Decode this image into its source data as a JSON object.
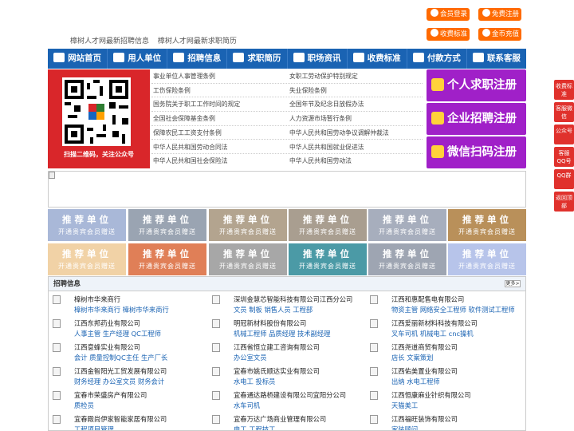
{
  "header": {
    "links": [
      "樟树人才网最新招聘信息",
      "樟树人才网最新求职简历"
    ],
    "buttons": [
      {
        "label": "会员登录",
        "icon": "user-icon"
      },
      {
        "label": "免费注册",
        "icon": "register-icon"
      },
      {
        "label": "收费标准",
        "icon": "yen-icon"
      },
      {
        "label": "金币充值",
        "icon": "coin-icon"
      }
    ]
  },
  "nav": [
    {
      "label": "网站首页",
      "icon": "home-icon"
    },
    {
      "label": "用人单位",
      "icon": "building-icon"
    },
    {
      "label": "招聘信息",
      "icon": "recruit-icon"
    },
    {
      "label": "求职简历",
      "icon": "resume-icon"
    },
    {
      "label": "职场资讯",
      "icon": "news-icon"
    },
    {
      "label": "收费标准",
      "icon": "fee-icon"
    },
    {
      "label": "付款方式",
      "icon": "payment-icon"
    },
    {
      "label": "联系客服",
      "icon": "service-icon"
    }
  ],
  "qr": {
    "caption": "扫描二维码，关注公众号"
  },
  "laws": [
    [
      "事业单位人事管理条例",
      "女职工劳动保护特别规定"
    ],
    [
      "工伤保险条例",
      "失业保险条例"
    ],
    [
      "国务院关于职工工作时间的规定",
      "全国年节及纪念日放假办法"
    ],
    [
      "全国社会保障基金条例",
      "人力资源市场暂行条例"
    ],
    [
      "保障农民工工资支付条例",
      "中华人民共和国劳动争议调解仲裁法"
    ],
    [
      "中华人民共和国劳动合同法",
      "中华人民共和国就业促进法"
    ],
    [
      "中华人民共和国社会保险法",
      "中华人民共和国劳动法"
    ]
  ],
  "register": [
    {
      "label": "个人求职注册",
      "icon": "person-icon"
    },
    {
      "label": "企业招聘注册",
      "icon": "company-icon"
    },
    {
      "label": "微信扫码注册",
      "icon": "wechat-icon"
    }
  ],
  "ads": {
    "title": "推荐单位",
    "subtitle": "开通贵宾会员赠送",
    "colors": [
      "#a9b8d8",
      "#9aa4b2",
      "#b3a48f",
      "#a99e90",
      "#a7aebd",
      "#b9905a",
      "#f1d2a6",
      "#e07f57",
      "#a7a7a7",
      "#4b9aa6",
      "#9ea5b2",
      "#b7c4ea"
    ]
  },
  "jobs": {
    "title": "招聘信息",
    "more": "更多>",
    "items": [
      {
        "company": "樟树市华来商行",
        "positions": "樟树市华来商行 樟树市华来商行"
      },
      {
        "company": "深圳金慧芯智能科技有限公司江西分公司",
        "positions": "文员 制板 销售人员 工程部"
      },
      {
        "company": "江西和惠配售电有限公司",
        "positions": "物资主管 网络安全工程师 软件测试工程师"
      },
      {
        "company": "江西东邦药业有限公司",
        "positions": "人事主管 生产经理 QC工程师"
      },
      {
        "company": "明冠新材料股份有限公司",
        "positions": "机械工程师 品质经理 技术副经理"
      },
      {
        "company": "江西爱丽新材料科技有限公司",
        "positions": "叉车司机 机械电工 cnc操机"
      },
      {
        "company": "江西意蜂实业有限公司",
        "positions": "会计 质量控制QC主任 生产厂长"
      },
      {
        "company": "江西省恒立建工咨询有限公司",
        "positions": "办公室文员"
      },
      {
        "company": "江西尧道商贸有限公司",
        "positions": "店长 文案策划"
      },
      {
        "company": "江西金智阳光工贸发展有限公司",
        "positions": "财务经理 办公室文员 财务会计"
      },
      {
        "company": "宜春市姚氏顺达实业有限公司",
        "positions": "水电工 投标员"
      },
      {
        "company": "江西佑美置业有限公司",
        "positions": "出纳 水电工程师"
      },
      {
        "company": "宜春市荣盛房产有限公司",
        "positions": "质检员"
      },
      {
        "company": "宜春通达路桥建设有限公司宜阳分公司",
        "positions": "水车司机"
      },
      {
        "company": "江西恒康麻业针织有限公司",
        "positions": "天猫美工"
      },
      {
        "company": "宜春殿尚伊家智能家居有限公司",
        "positions": "工程项目管理"
      },
      {
        "company": "宜春万达广场商业管理有限公司",
        "positions": "电工 工程技工"
      },
      {
        "company": "江西福旺装饰有限公司",
        "positions": "家装顾问"
      }
    ]
  },
  "sidebar": [
    "收费标准",
    "客服微信",
    "公众号",
    "客服QQ号",
    "QQ群",
    "返回顶部"
  ]
}
